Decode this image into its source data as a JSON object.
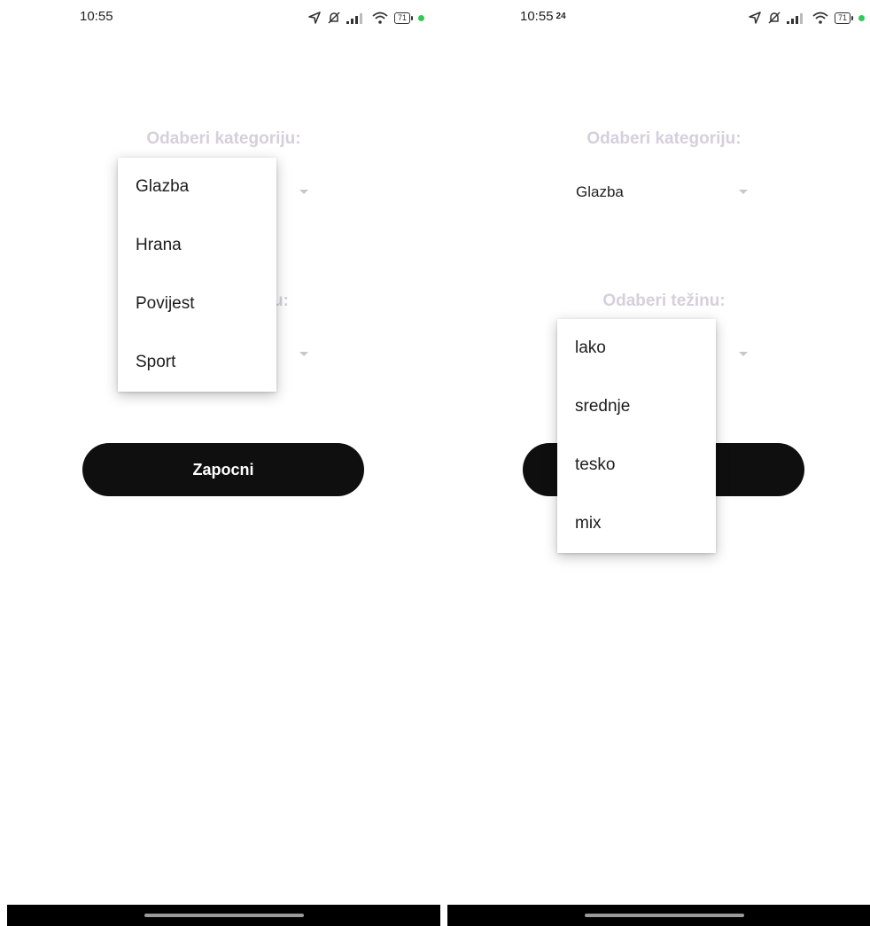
{
  "left": {
    "status": {
      "time": "10:55"
    },
    "category_label": "Odaberi kategoriju:",
    "difficulty_label_partial": "u:",
    "start_button": "Zapocni",
    "category_menu": {
      "items": [
        "Glazba",
        "Hrana",
        "Povijest",
        "Sport"
      ]
    }
  },
  "right": {
    "status": {
      "time": "10:55",
      "time_suffix": "24"
    },
    "category_label": "Odaberi kategoriju:",
    "category_selected": "Glazba",
    "difficulty_label": "Odaberi težinu:",
    "difficulty_menu": {
      "items": [
        "lako",
        "srednje",
        "tesko",
        "mix"
      ]
    }
  },
  "icons": {
    "status": [
      "location-arrow-icon",
      "mute-bell-icon",
      "signal-bars-icon",
      "wifi-icon",
      "battery-icon",
      "camera-indicator-dot"
    ],
    "dropdown": "chevron-down-icon"
  },
  "battery_level": "71",
  "colors": {
    "label": "#d4d0dc",
    "button": "#0f0f0f",
    "indicator_dot": "#2ecc55"
  }
}
